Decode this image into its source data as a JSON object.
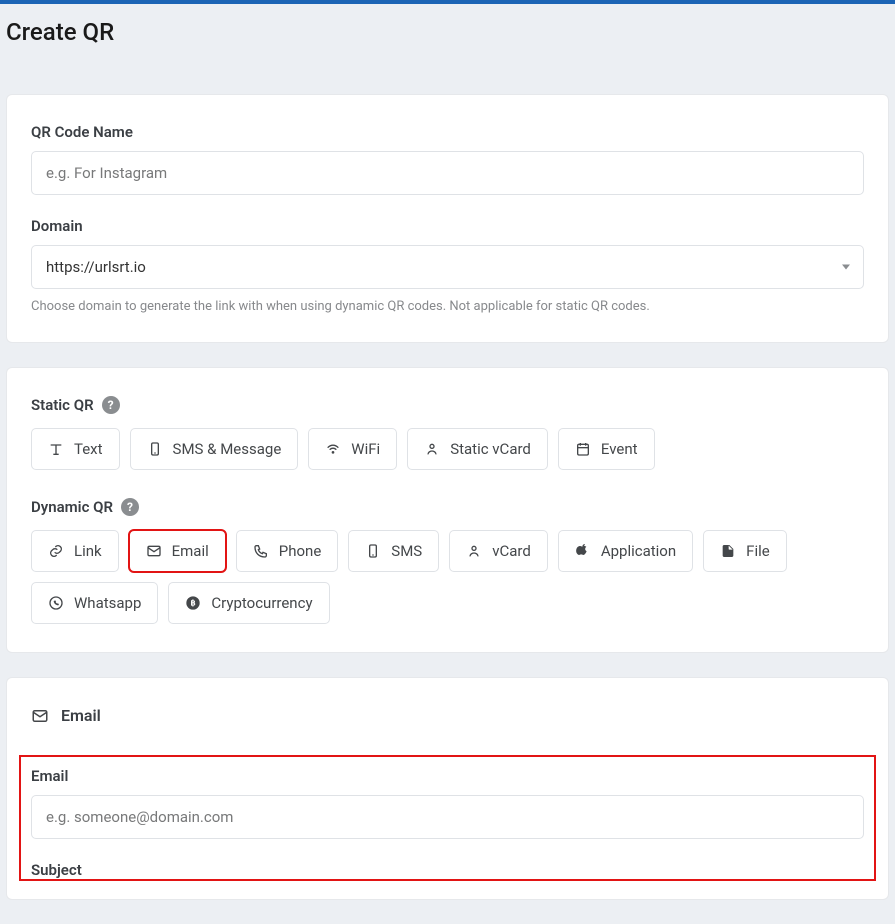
{
  "page": {
    "title": "Create QR"
  },
  "form": {
    "name": {
      "label": "QR Code Name",
      "placeholder": "e.g. For Instagram",
      "value": ""
    },
    "domain": {
      "label": "Domain",
      "selected": "https://urlsrt.io",
      "help": "Choose domain to generate the link with when using dynamic QR codes. Not applicable for static QR codes."
    }
  },
  "types": {
    "static_label": "Static QR",
    "dynamic_label": "Dynamic QR",
    "static": [
      {
        "label": "Text"
      },
      {
        "label": "SMS & Message"
      },
      {
        "label": "WiFi"
      },
      {
        "label": "Static vCard"
      },
      {
        "label": "Event"
      }
    ],
    "dynamic": [
      {
        "label": "Link"
      },
      {
        "label": "Email"
      },
      {
        "label": "Phone"
      },
      {
        "label": "SMS"
      },
      {
        "label": "vCard"
      },
      {
        "label": "Application"
      },
      {
        "label": "File"
      },
      {
        "label": "Whatsapp"
      },
      {
        "label": "Cryptocurrency"
      }
    ]
  },
  "email_section": {
    "header": "Email",
    "email": {
      "label": "Email",
      "placeholder": "e.g. someone@domain.com",
      "value": ""
    },
    "subject": {
      "label": "Subject"
    }
  }
}
